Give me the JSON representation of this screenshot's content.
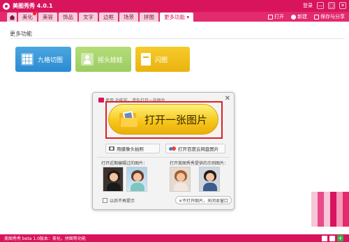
{
  "app": {
    "title": "美图秀秀 4.0.1"
  },
  "titlebar": {
    "login": "登录",
    "minimize": "—",
    "maximize": "□",
    "close": "✕"
  },
  "menu": {
    "tabs": [
      {
        "label": "美化"
      },
      {
        "label": "美容"
      },
      {
        "label": "饰品"
      },
      {
        "label": "文字"
      },
      {
        "label": "边框"
      },
      {
        "label": "场景"
      },
      {
        "label": "拼图"
      },
      {
        "label": "更多功能 ▾"
      }
    ],
    "right": {
      "open": "打开",
      "new": "新建",
      "save_share": "保存与分享"
    }
  },
  "main": {
    "section_title": "更多功能",
    "features": [
      {
        "label": "九格切图"
      },
      {
        "label": "摇头娃娃"
      },
      {
        "label": "闪图"
      }
    ]
  },
  "dialog": {
    "tip": "使用 功能前，请先打开一张图片",
    "open_button": "打开一张图片",
    "camera_button": "用摄像头拍照",
    "cloud_button": "打开百度云网盘图片",
    "recent_label": "打开近期编辑过的图片：",
    "sample_label": "打开美图秀秀提供的示例图片：",
    "dont_show": "以后不再提示",
    "no_picture_button": "✕不打开图片，关闭本窗口",
    "close": "✕"
  },
  "statusbar": {
    "text": "美图秀秀 beta 1.0版本：美化，拼图等功能"
  },
  "colors": {
    "brand": "#d8155c",
    "highlight": "#e02020",
    "open_button": "#f5c518"
  }
}
